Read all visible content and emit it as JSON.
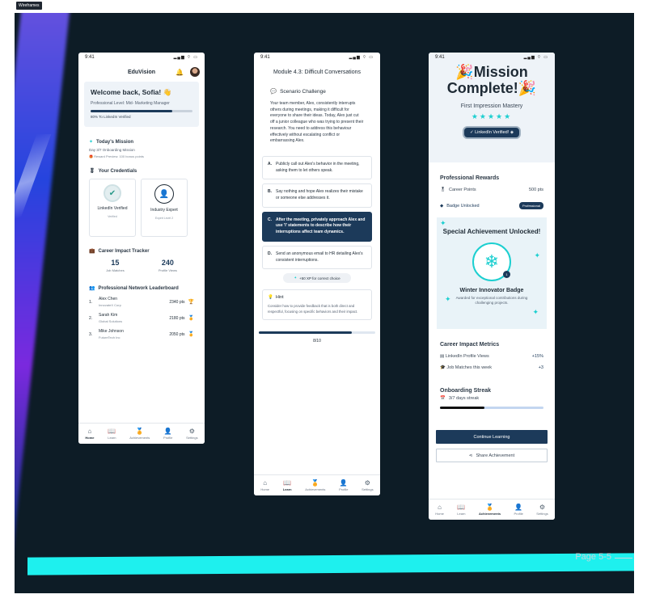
{
  "tool_tag": "Wireframes",
  "page_label": "Page 5-5",
  "status_time": "9:41",
  "status_icons": "▂▄▆ ⌔ ▭",
  "nav_items": [
    {
      "label": "Home",
      "icon": "⌂"
    },
    {
      "label": "Learn",
      "icon": "📖"
    },
    {
      "label": "Achievements",
      "icon": "🏅"
    },
    {
      "label": "Profile",
      "icon": "👤"
    },
    {
      "label": "Settings",
      "icon": "⚙"
    }
  ],
  "phone1": {
    "app_title": "EduVision",
    "welcome": "Welcome back, Sofia! 👋",
    "level": "Professional Level: Mid- Marketing Manager",
    "verified_pct": 0.8,
    "verified_text": "80% To LinkedIn Verified",
    "mission_title": "Today's Mission",
    "mission_sub": "Day 3/7 Onboarding Mission",
    "mission_reward": "Reward Preview: 100 bonus points",
    "cred_title": "Your Credentials",
    "cred1": {
      "name": "LinkedIn Verified",
      "status": "Verified"
    },
    "cred2": {
      "name": "Industry Expert",
      "status": "Expert Level 2"
    },
    "tracker_title": "Career Impact Tracker",
    "stat1": {
      "value": "15",
      "label": "Job Matches"
    },
    "stat2": {
      "value": "240",
      "label": "Profile Views"
    },
    "leaderboard_title": "Professional Network Leaderboard",
    "leaders": [
      {
        "rank": "1.",
        "name": "Alex Chen",
        "org": "InnovateX Corp",
        "pts": "2340 pts"
      },
      {
        "rank": "2.",
        "name": "Sarah Kim",
        "org": "Global Solutions",
        "pts": "2180 pts"
      },
      {
        "rank": "3.",
        "name": "Mike Johnson",
        "org": "FutureTech Inc",
        "pts": "2050 pts"
      }
    ],
    "active_nav": "Home"
  },
  "phone2": {
    "module_title": "Module 4.3: Difficult Conversations",
    "scenario_title": "Scenario Challenge",
    "scenario_body": "Your team member, Alex, consistently interrupts others during meetings, making it difficult for everyone to share their ideas. Today, Alex just cut off a junior colleague who was trying to present their research. You need to address this behaviour effectively without escalating conflict or embarrassing Alex.",
    "options": [
      {
        "key": "A.",
        "text": "Publicly call out Alex's behavior in the meeting, asking them to let others speak."
      },
      {
        "key": "B.",
        "text": "Say nothing and hope Alex realizes their mistake or someone else addresses it."
      },
      {
        "key": "C.",
        "text": "After the meeting, privately approach Alex and use 'I' statements to describe how their interruptions affect team dynamics."
      },
      {
        "key": "D.",
        "text": "Send an anonymous email to HR detailing Alex's consistent interruptions."
      }
    ],
    "selected_option": 2,
    "xp_text": "+50 XP for correct choice",
    "hint_title": "Hint",
    "hint_body": "Consider how to provide feedback that is both direct and respectful, focusing on specific behaviors and their impact.",
    "progress": 0.8,
    "progress_label": "8/10",
    "active_nav": "Learn"
  },
  "phone3": {
    "hero_title": "Mission Complete!",
    "hero_sub": "First Impression Mastery",
    "stars": "★★★★★",
    "verified_label": "LinkedIn Verified!",
    "rewards_title": "Professional Rewards",
    "career_points_label": "Career Points",
    "career_points_value": "500 pts",
    "badge_unlocked_label": "Badge Unlocked",
    "badge_pill": "Professional",
    "special_title": "Special Achievement Unlocked!",
    "badge_count": "1",
    "badge_name": "Winter Innovator Badge",
    "badge_desc": "Awarded for exceptional contributions during challenging projects.",
    "metrics_title": "Career Impact Metrics",
    "metric1": {
      "label": "LinkedIn Profile Views",
      "value": "+15%"
    },
    "metric2": {
      "label": "Job Matches this week",
      "value": "+3"
    },
    "streak_title": "Onboarding Streak",
    "streak_text": "3/7 days streak",
    "streak_ratio": 0.43,
    "continue_label": "Continue Learning",
    "share_label": "Share Achievement",
    "active_nav": "Achievements",
    "achievements_count": "1"
  }
}
